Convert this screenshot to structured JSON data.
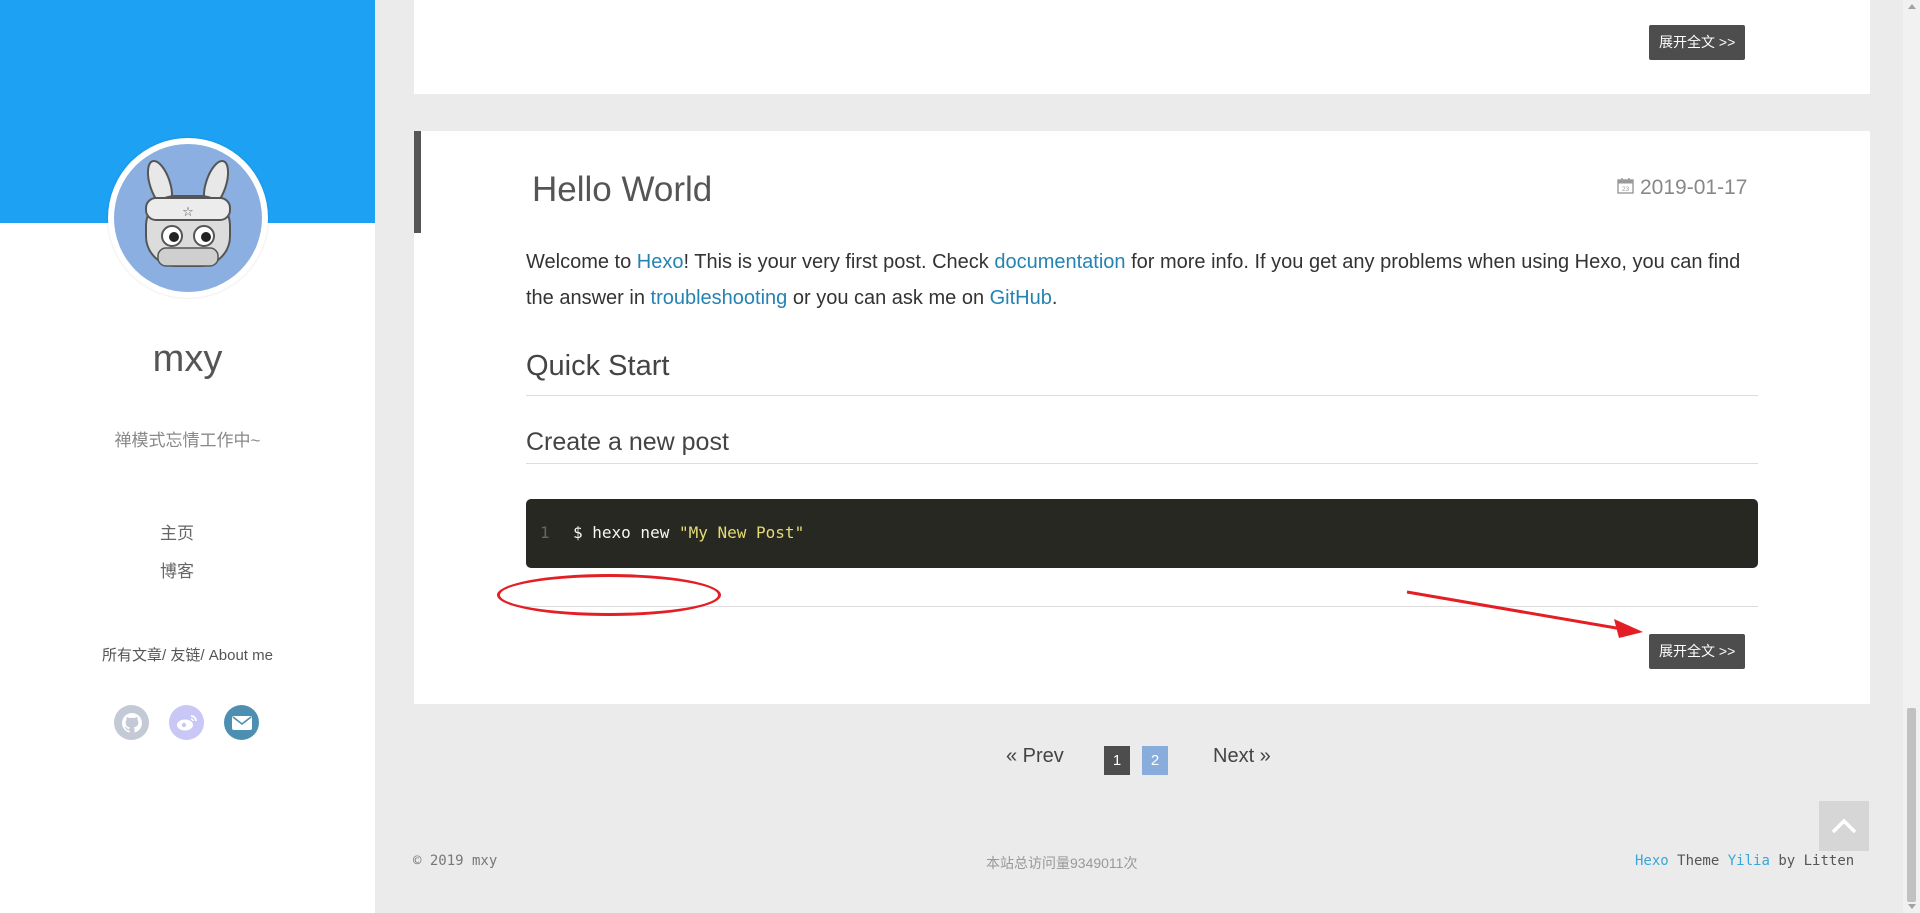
{
  "sidebar": {
    "author_name": "mxy",
    "bio": "禅模式忘情工作中~",
    "nav": [
      {
        "label": "主页"
      },
      {
        "label": "博客"
      }
    ],
    "sub_links": [
      "所有文章",
      "友链",
      "About me"
    ],
    "sub_sep": "/ ",
    "socials": [
      {
        "icon": "github-icon",
        "color": "#c4c9d6"
      },
      {
        "icon": "weibo-icon",
        "color": "#c9c7f5"
      },
      {
        "icon": "mail-icon",
        "color": "#4d8fb3"
      }
    ],
    "banner_color": "#1da1f2"
  },
  "top_card": {
    "more_button": "展开全文 >>"
  },
  "post": {
    "title": "Hello World",
    "date": "2019-01-17",
    "intro": {
      "t1": "Welcome to ",
      "l1": "Hexo",
      "t2": "! This is your very first post. Check ",
      "l2": "documentation",
      "t3": " for more info. If you get any problems when using Hexo, you can find the answer in ",
      "l3": "troubleshooting",
      "t4": " or you can ask me on ",
      "l4": "GitHub",
      "t5": "."
    },
    "h2": "Quick Start",
    "h3": "Create a new post",
    "code": {
      "line_no": "1",
      "command": "$ hexo new ",
      "string": "\"My New Post\""
    },
    "more_button": "展开全文 >>"
  },
  "pagination": {
    "prev": "« Prev",
    "pages": [
      "1",
      "2"
    ],
    "current": "1",
    "next": "Next »"
  },
  "footer": {
    "copyright": "© 2019 mxy",
    "visits": "本站总访问量9349011次",
    "powered_1": "Hexo",
    "powered_2": " Theme ",
    "powered_3": "Yilia",
    "powered_4": " by Litten"
  },
  "annotation_color": "#e31e24"
}
